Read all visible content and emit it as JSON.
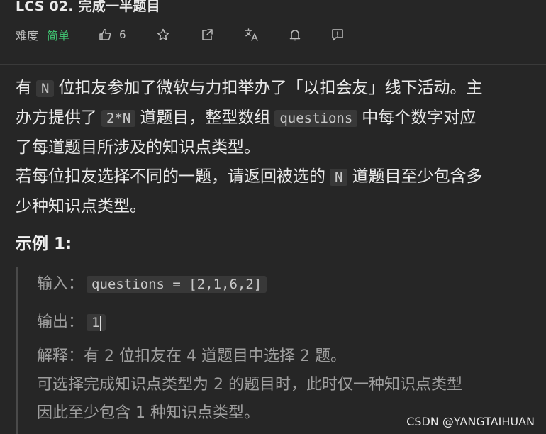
{
  "problem": {
    "title": "LCS 02. 完成一半题目",
    "difficulty_label": "难度",
    "difficulty": "简单",
    "like_count": "6"
  },
  "icons": {
    "like": "thumbs-up-icon",
    "star": "star-icon",
    "share": "share-icon",
    "translate": "translate-icon",
    "notify": "bell-icon",
    "feedback": "feedback-icon"
  },
  "description": {
    "p1_a": "有",
    "p1_code1": "N",
    "p1_b": "位扣友参加了微软与力扣举办了「以扣会友」线下活动。主",
    "p1_c": "办方提供了",
    "p1_code2": "2*N",
    "p1_d": "道题目，整型数组",
    "p1_code3": "questions",
    "p1_e": "中每个数字对应",
    "p1_f": "了每道题目所涉及的知识点类型。",
    "p2_a": "若每位扣友选择不同的一题，请返回被选的",
    "p2_code": "N",
    "p2_b": "道题目至少包含多",
    "p2_c": "少种知识点类型。"
  },
  "example": {
    "title": "示例 1:",
    "input_label": "输入：",
    "input_value": "questions = [2,1,6,2]",
    "output_label": "输出：",
    "output_value": "1",
    "explain_1": "解释：有 2 位扣友在 4 道题目中选择 2 题。",
    "explain_2": "可选择完成知识点类型为 2 的题目时，此时仅一种知识点类型",
    "explain_3": "因此至少包含 1 种知识点类型。"
  },
  "watermark": "CSDN @YANGTAIHUAN",
  "colors": {
    "background": "#262626",
    "difficulty_easy": "#3fbf6f",
    "code_bg": "#383838"
  }
}
